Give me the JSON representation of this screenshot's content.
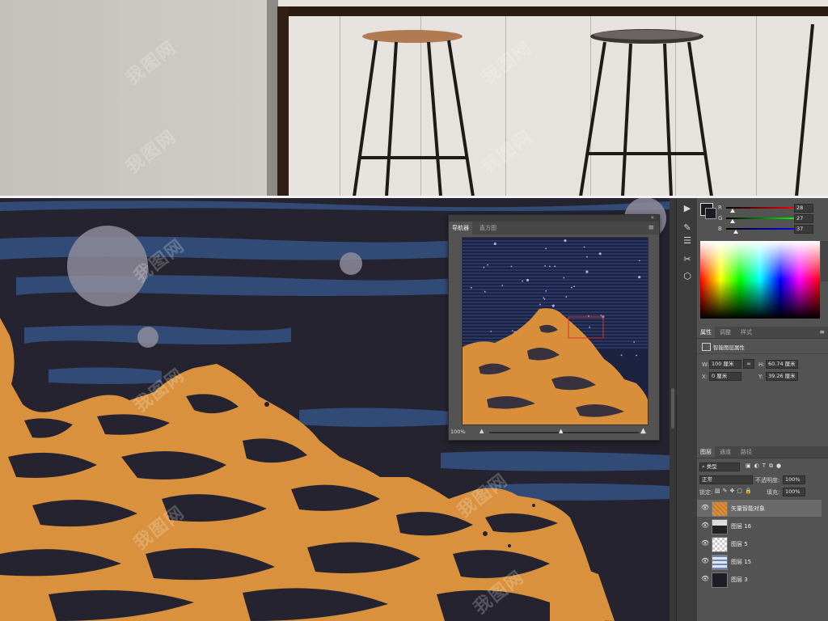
{
  "colors": {
    "canvas_bg": "#24232f",
    "mountain_orange": "#d9913d",
    "stripe_blue": "#34507e",
    "panel_bg": "#535353",
    "panel_dark": "#3a3a3a",
    "selection_red": "#e03030"
  },
  "watermark_text": "我图网",
  "color_panel": {
    "r_label": "R",
    "r_value": "28",
    "g_label": "G",
    "g_value": "27",
    "b_label": "B",
    "b_value": "37"
  },
  "properties_panel": {
    "tabs": [
      "属性",
      "调整",
      "样式"
    ],
    "title": "智能图层属性",
    "w_label": "W:",
    "w_value": "100 厘米",
    "h_label": "H:",
    "h_value": "60.74 厘米",
    "x_label": "X:",
    "x_value": "0 厘米",
    "y_label": "Y:",
    "y_value": "39.26 厘米"
  },
  "layers_panel": {
    "tabs": [
      "图层",
      "通道",
      "路径"
    ],
    "filter_kind": "类型",
    "blend_mode": "正常",
    "opacity_label": "不透明度:",
    "opacity_value": "100%",
    "lock_label": "锁定:",
    "fill_label": "填充:",
    "fill_value": "100%",
    "layers": [
      {
        "name": "矢量智能对象",
        "selected": true
      },
      {
        "name": "图层 16",
        "selected": false
      },
      {
        "name": "图层 5",
        "selected": false
      },
      {
        "name": "图层 15",
        "selected": false
      },
      {
        "name": "图层 3",
        "selected": false
      }
    ]
  },
  "navigator": {
    "tabs": [
      "导航器",
      "直方图"
    ],
    "zoom": "100%"
  },
  "icons": [
    "play-icon",
    "brush-icon",
    "sliders-icon",
    "scissors-icon",
    "cube-icon",
    "eye-icon",
    "link-icon",
    "menu-icon"
  ]
}
